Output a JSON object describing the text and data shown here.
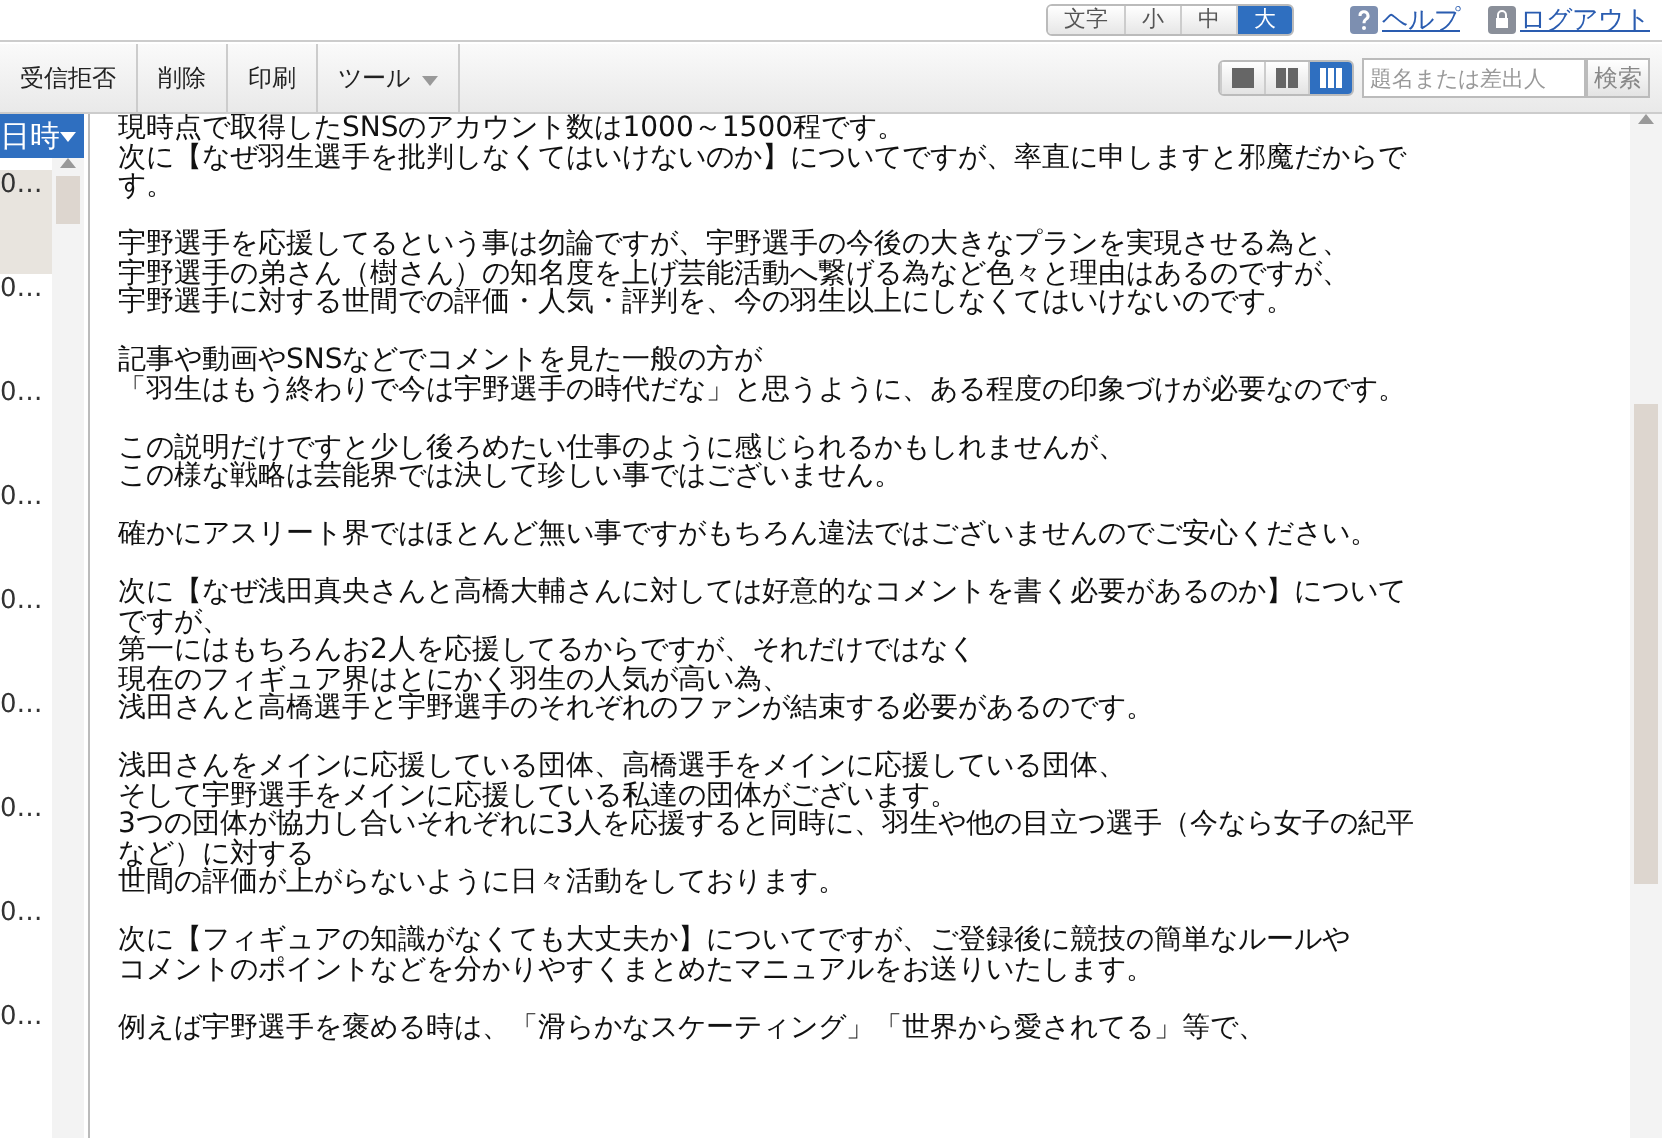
{
  "header": {
    "size_label": "文字",
    "sizes": [
      {
        "label": "小",
        "selected": false
      },
      {
        "label": "中",
        "selected": false
      },
      {
        "label": "大",
        "selected": true
      }
    ],
    "links": [
      "ヘルプ",
      "ログアウト"
    ]
  },
  "toolbar": {
    "buttons": [
      "受信拒否",
      "削除",
      "印刷"
    ],
    "menu": "ツール",
    "views": [
      {
        "selected": false
      },
      {
        "selected": false
      },
      {
        "selected": true
      }
    ],
    "search": {
      "placeholder": "題名または差出人"
    },
    "search_button": "検索"
  },
  "list": {
    "header": "日時",
    "items": [
      {
        "label": "0…",
        "selected": true
      },
      {
        "label": "0…",
        "selected": false
      },
      {
        "label": "0…",
        "selected": false
      },
      {
        "label": "0…",
        "selected": false
      },
      {
        "label": "0…",
        "selected": false
      },
      {
        "label": "0…",
        "selected": false
      },
      {
        "label": "0…",
        "selected": false
      },
      {
        "label": "0…",
        "selected": false
      },
      {
        "label": "0…",
        "selected": false
      }
    ]
  },
  "message": {
    "paragraphs": [
      [
        "現時点で取得したSNSのアカウント数は1000～1500程です。",
        "次に【なぜ羽生選手を批判しなくてはいけないのか】についてですが、率直に申しますと邪魔だからで",
        "す。"
      ],
      [
        "宇野選手を応援してるという事は勿論ですが、宇野選手の今後の大きなプランを実現させる為と、",
        "宇野選手の弟さん（樹さん）の知名度を上げ芸能活動へ繋げる為など色々と理由はあるのですが、",
        "宇野選手に対する世間での評価・人気・評判を、今の羽生以上にしなくてはいけないのです。"
      ],
      [
        "記事や動画やSNSなどでコメントを見た一般の方が",
        "「羽生はもう終わりで今は宇野選手の時代だな」と思うように、ある程度の印象づけが必要なのです。"
      ],
      [
        "この説明だけですと少し後ろめたい仕事のように感じられるかもしれませんが、",
        "この様な戦略は芸能界では決して珍しい事ではございません。"
      ],
      [
        "確かにアスリート界ではほとんど無い事ですがもちろん違法ではございませんのでご安心ください。"
      ],
      [
        "次に【なぜ浅田真央さんと高橋大輔さんに対しては好意的なコメントを書く必要があるのか】について",
        "ですが、",
        "第一にはもちろんお2人を応援してるからですが、それだけではなく",
        "現在のフィギュア界はとにかく羽生の人気が高い為、",
        "浅田さんと高橋選手と宇野選手のそれぞれのファンが結束する必要があるのです。"
      ],
      [
        "浅田さんをメインに応援している団体、高橋選手をメインに応援している団体、",
        "そして宇野選手をメインに応援している私達の団体がございます。",
        "3つの団体が協力し合いそれぞれに3人を応援すると同時に、羽生や他の目立つ選手（今なら女子の紀平",
        "など）に対する",
        "世間の評価が上がらないように日々活動をしております。"
      ],
      [
        "次に【フィギュアの知識がなくても大丈夫か】についてですが、ご登録後に競技の簡単なルールや",
        "コメントのポイントなどを分かりやすくまとめたマニュアルをお送りいたします。"
      ],
      [
        "例えば宇野選手を褒める時は、「滑らかなスケーティング」「世界から愛されてる」等で、"
      ]
    ]
  }
}
